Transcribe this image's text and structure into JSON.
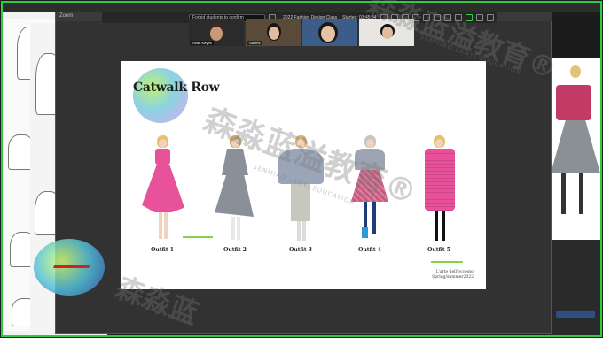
{
  "zoom": {
    "window_title": "Zoom",
    "spotlight_select": "Forbid students to confirm",
    "meeting_title": "2022 Fashion Design Class",
    "timer": "Started: 03:45:34",
    "participants": [
      {
        "name": "Sean Keyes",
        "bg": "#2b2b2b",
        "skin": "#c79a7c",
        "hair": "#3a2a20"
      },
      {
        "name": "Sammi",
        "bg": "#5a4a3a",
        "skin": "#e2bca0",
        "hair": "#1c1410"
      },
      {
        "name": "",
        "bg": "#3c5d8a",
        "skin": "#e6c2a6",
        "hair": "#201814"
      },
      {
        "name": "",
        "bg": "#e8e6e2",
        "skin": "#e0bda0",
        "hair": "#1a1410"
      }
    ]
  },
  "slide": {
    "title": "Catwalk Row",
    "outfits": [
      {
        "label": "Outfit 1",
        "main_color": "#e8529a",
        "hair_color": "#e8c066"
      },
      {
        "label": "Outfit 2",
        "main_color": "#8a8f99",
        "hair_color": "#c9a26a"
      },
      {
        "label": "Outfit 3",
        "main_color": "#9ba5b8",
        "hair_color": "#d8b070"
      },
      {
        "label": "Outfit 4",
        "main_color": "#c85a80",
        "hair_color": "#c9c4bf"
      },
      {
        "label": "Outfit 5",
        "main_color": "#e8519a",
        "hair_color": "#e3c070"
      }
    ],
    "credit_line1": "L'arte dell'eccesso",
    "credit_line2": "Spring/summer2022"
  },
  "watermark": {
    "text_cn": "森淼蓝溢教育",
    "text_en": "SENMIAO LANYI EDUCATION"
  },
  "colors": {
    "share_border": "#2ecc40",
    "accent_green": "#8ad04a"
  }
}
